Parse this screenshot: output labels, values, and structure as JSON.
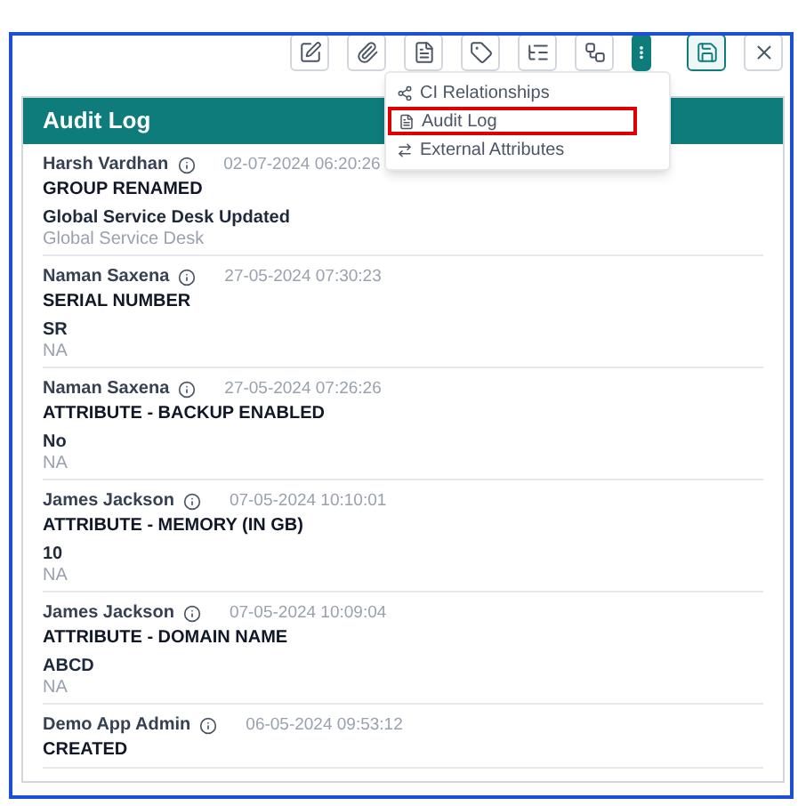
{
  "toolbar": {
    "buttons": [
      {
        "kind": "edit",
        "active": false
      },
      {
        "kind": "attach",
        "active": false
      },
      {
        "kind": "document",
        "active": false
      },
      {
        "kind": "tag",
        "active": false
      },
      {
        "kind": "tree",
        "active": false
      },
      {
        "kind": "network",
        "active": false
      },
      {
        "kind": "more",
        "active": true
      },
      {
        "kind": "save",
        "active": false
      },
      {
        "kind": "close",
        "active": false
      }
    ]
  },
  "menu": {
    "items": [
      {
        "kind": "relationships",
        "label": "CI Relationships",
        "highlighted": false
      },
      {
        "kind": "log",
        "label": "Audit Log",
        "highlighted": true
      },
      {
        "kind": "attributes",
        "label": "External Attributes",
        "highlighted": false
      }
    ]
  },
  "panel": {
    "title": "Audit Log",
    "entries": [
      {
        "user": "Harsh Vardhan",
        "time": "02-07-2024 06:20:26",
        "field": "GROUP RENAMED",
        "new_value": "Global Service Desk Updated",
        "old_value": "Global Service Desk"
      },
      {
        "user": "Naman Saxena",
        "time": "27-05-2024 07:30:23",
        "field": "SERIAL NUMBER",
        "new_value": "SR",
        "old_value": "NA"
      },
      {
        "user": "Naman Saxena",
        "time": "27-05-2024 07:26:26",
        "field": "ATTRIBUTE - BACKUP ENABLED",
        "new_value": "No",
        "old_value": "NA"
      },
      {
        "user": "James Jackson",
        "time": "07-05-2024 10:10:01",
        "field": "ATTRIBUTE - MEMORY (IN GB)",
        "new_value": "10",
        "old_value": "NA"
      },
      {
        "user": "James Jackson",
        "time": "07-05-2024 10:09:04",
        "field": "ATTRIBUTE - DOMAIN NAME",
        "new_value": "ABCD",
        "old_value": "NA"
      },
      {
        "user": "Demo App Admin",
        "time": "06-05-2024 09:53:12",
        "field": "CREATED"
      }
    ]
  }
}
